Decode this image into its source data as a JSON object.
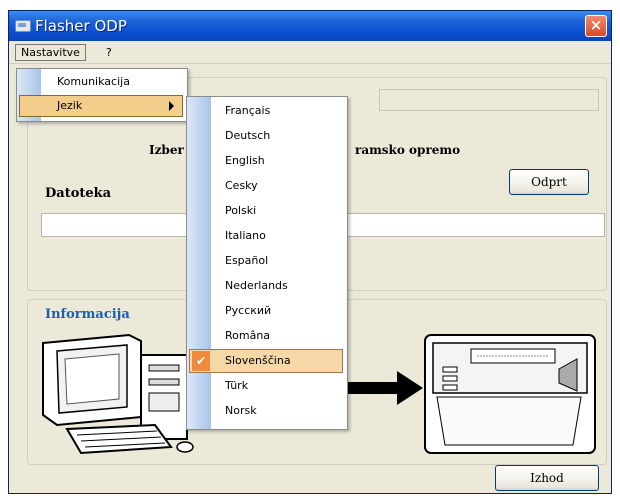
{
  "window": {
    "title": "Flasher ODP",
    "close_glyph": "×"
  },
  "menubar": {
    "items": [
      "Nastavitve",
      "?"
    ]
  },
  "settings_menu": {
    "items": [
      {
        "label": "Komunikacija",
        "has_submenu": false
      },
      {
        "label": "Jezik",
        "has_submenu": true,
        "highlighted": true
      }
    ]
  },
  "language_menu": {
    "items": [
      "Français",
      "Deutsch",
      "English",
      "Cesky",
      "Polski",
      "Italiano",
      "Español",
      "Nederlands",
      "Русский",
      "Româna",
      "Slovenščina",
      "Türk",
      "Norsk"
    ],
    "selected": "Slovenščina",
    "check_glyph": "✔"
  },
  "main": {
    "heading_left": "Izber",
    "heading_right": "ramsko opremo",
    "file_label": "Datoteka",
    "open_button": "Odprt",
    "file_path": ""
  },
  "info": {
    "label": "Informacija"
  },
  "footer": {
    "exit_button": "Izhod"
  },
  "colors": {
    "title_bar": "#0b4fd2",
    "menu_highlight": "#f2cd8c",
    "info_label": "#1f5bb8",
    "check": "#f08a3c"
  }
}
